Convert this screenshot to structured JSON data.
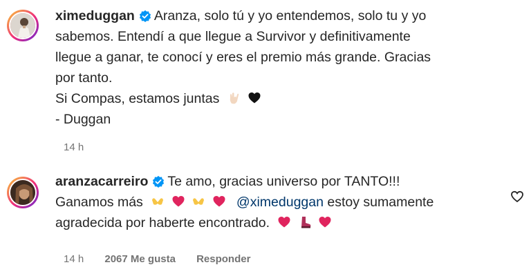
{
  "comments": [
    {
      "username": "ximeduggan",
      "lines": [
        "Aranza, solo tú y yo entendemos, solo tu y yo",
        "sabemos. Entendí a que llegue a Survivor y definitivamente",
        "llegue a ganar, te conocí y eres el premio más grande. Gracias",
        "por tanto.",
        "Si Compas, estamos juntas",
        "- Duggan"
      ],
      "time": "14 h"
    },
    {
      "username": "aranzacarreiro",
      "line1": "Te amo, gracias universo por TANTO!!!",
      "line2_a": "Ganamos más",
      "mention": "@ximeduggan",
      "line2_b": "estoy sumamente",
      "line3": "agradecida por haberte encontrado.",
      "time": "14 h",
      "likes": "2067 Me gusta",
      "reply": "Responder"
    }
  ],
  "icons": {
    "verified": "verified-badge-icon",
    "like": "heart-outline-icon",
    "hand": "hand-sign-emoji",
    "black_heart": "black-heart-emoji",
    "red_heart": "red-heart-emoji",
    "heart_hands": "heart-hands-emoji",
    "boot": "boot-emoji"
  },
  "colors": {
    "verified": "#0095f6",
    "meta": "#737373",
    "mention": "#00376b",
    "heart": "#e0245e"
  }
}
